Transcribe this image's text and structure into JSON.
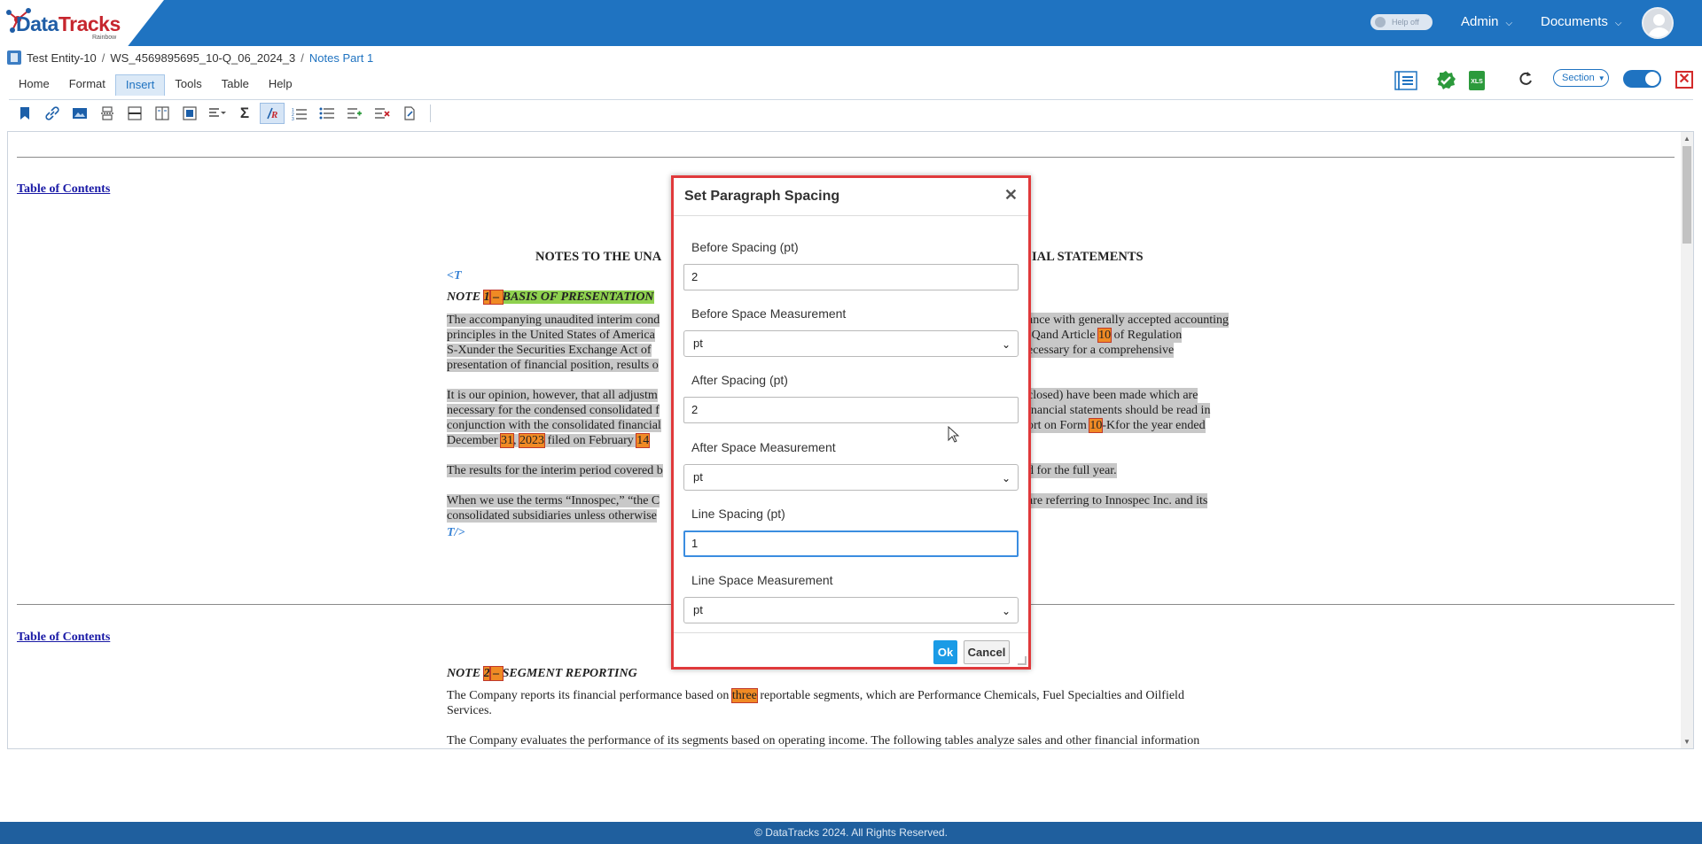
{
  "app": {
    "logo_text_1": "Data",
    "logo_text_2": "Tracks",
    "logo_sub": "Rainbow",
    "help_toggle": "Help off",
    "nav_admin": "Admin",
    "nav_documents": "Documents"
  },
  "breadcrumb": {
    "entity": "Test Entity-10",
    "workspace": "WS_4569895695_10-Q_06_2024_3",
    "current": "Notes Part 1"
  },
  "menu": {
    "tabs": [
      "Home",
      "Format",
      "Insert",
      "Tools",
      "Table",
      "Help"
    ],
    "active": "Insert"
  },
  "header_tools": {
    "section_label": "Section"
  },
  "document": {
    "toc_label": "Table of Contents",
    "heading": "NOTES TO THE UNA",
    "heading_tail": "IAL STATEMENTS",
    "tag_open": "<T",
    "tag_close": "T/>",
    "note1_prefix": "NOTE ",
    "note1_num": "1",
    "note1_dash": " – ",
    "note1_title": "BASIS OF PRESENTATION",
    "p1_l1a": "The accompanying unaudited interim cond",
    "p1_l1b": "ance with generally accepted accounting",
    "p1_l2a": "principles in the United States of America",
    "p1_l2b": "-Qand Article ",
    "p1_l2num": "10",
    "p1_l2c": " of Regulation",
    "p1_l3a": "S-Xunder the Securities Exchange Act of ",
    "p1_l3b": "ecessary for a comprehensive",
    "p1_l4a": "presentation of financial position, results o",
    "p2_l1a": "It is our opinion, however, that all adjustm",
    "p2_l1b": "closed) have been made which are",
    "p2_l2a": "necessary for the condensed consolidated f",
    "p2_l2b": "inancial statements should be read in",
    "p2_l3a": "conjunction with the consolidated financial",
    "p2_l3b": "ort on Form ",
    "p2_l3num": "10",
    "p2_l3c": "-Kfor the year ended",
    "p2_l4a": "December ",
    "p2_l4n1": "31",
    "p2_l4b": ", ",
    "p2_l4n2": "2023",
    "p2_l4c": " filed on February ",
    "p2_l4n3": "14",
    "p3_a": "The results for the interim period covered b",
    "p3_b": "d for the full year.",
    "p4_l1a": "When we use the terms “Innospec,” “the C",
    "p4_l1b": "are referring to Innospec Inc. and its",
    "p4_l2a": "consolidated subsidiaries unless otherwise",
    "note2_prefix": "NOTE ",
    "note2_num": "2",
    "note2_dash": " – ",
    "note2_title": "SEGMENT REPORTING",
    "p5_a": "The Company reports its financial performance based on ",
    "p5_hl": "three",
    "p5_b": " reportable segments, which are Performance Chemicals, Fuel Specialties and Oilfield",
    "p5_c": "Services.",
    "p6": "The Company evaluates the performance of its segments based on operating income. The following tables analyze sales and other financial information"
  },
  "dialog": {
    "title": "Set Paragraph Spacing",
    "before_spacing_label": "Before Spacing (pt)",
    "before_spacing_value": "2",
    "before_measure_label": "Before Space Measurement",
    "before_measure_value": "pt",
    "after_spacing_label": "After Spacing (pt)",
    "after_spacing_value": "2",
    "after_measure_label": "After Space Measurement",
    "after_measure_value": "pt",
    "line_spacing_label": "Line Spacing (pt)",
    "line_spacing_value": "1",
    "line_measure_label": "Line Space Measurement",
    "line_measure_value": "pt",
    "ok_label": "Ok",
    "cancel_label": "Cancel"
  },
  "footer": {
    "text": "© DataTracks 2024. All Rights Reserved."
  },
  "colors": {
    "brand_blue": "#1f73c1",
    "dialog_border": "#e0393b",
    "ok_button": "#1a9be6",
    "footer": "#1f5f9e"
  }
}
